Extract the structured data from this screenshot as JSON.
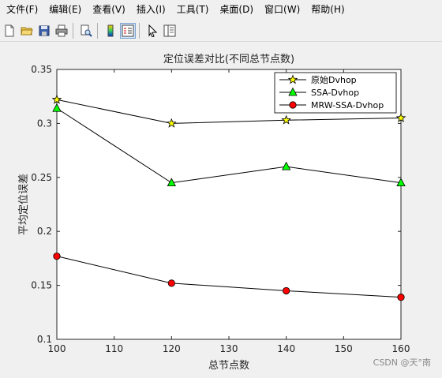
{
  "menu": [
    "文件(F)",
    "编辑(E)",
    "查看(V)",
    "插入(I)",
    "工具(T)",
    "桌面(D)",
    "窗口(W)",
    "帮助(H)"
  ],
  "toolbar": [
    "new-file-icon",
    "open-folder-icon",
    "save-icon",
    "print-icon",
    "print-preview-icon",
    "colorbar-icon",
    "legend-icon",
    "pointer-icon",
    "property-editor-icon"
  ],
  "watermark": "CSDN @天°南",
  "chart_data": {
    "type": "line",
    "title": "定位误差对比(不同总节点数)",
    "xlabel": "总节点数",
    "ylabel": "平均定位误差",
    "x": [
      100,
      120,
      140,
      160
    ],
    "xlim": [
      100,
      160
    ],
    "ylim": [
      0.1,
      0.35
    ],
    "xticks": [
      "100",
      "110",
      "120",
      "130",
      "140",
      "150",
      "160"
    ],
    "yticks": [
      "0.1",
      "0.15",
      "0.2",
      "0.25",
      "0.3",
      "0.35"
    ],
    "legend_position": "top-right",
    "grid": false,
    "series": [
      {
        "name": "原始Dvhop",
        "values": [
          0.322,
          0.3,
          0.303,
          0.305
        ],
        "marker": "star",
        "color": "#ffff00"
      },
      {
        "name": "SSA-Dvhop",
        "values": [
          0.314,
          0.245,
          0.26,
          0.245
        ],
        "marker": "triangle",
        "color": "#00ff00"
      },
      {
        "name": "MRW-SSA-Dvhop",
        "values": [
          0.177,
          0.152,
          0.145,
          0.139
        ],
        "marker": "circle",
        "color": "#ff0000"
      }
    ]
  }
}
